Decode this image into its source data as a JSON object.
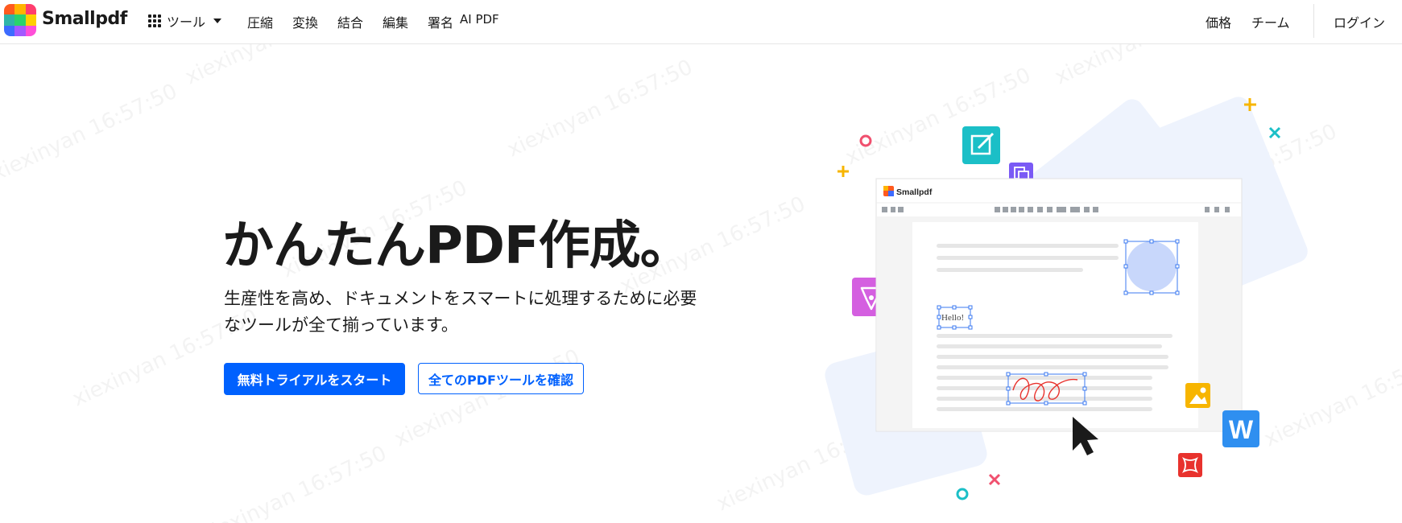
{
  "header": {
    "brand": "Smallpdf",
    "tools_label": "ツール",
    "nav": [
      "圧縮",
      "変換",
      "結合",
      "編集",
      "署名",
      "AI PDF"
    ],
    "price_label": "価格",
    "team_label": "チーム",
    "login_label": "ログイン"
  },
  "hero": {
    "title": "かんたんPDF作成。",
    "subtitle_line1": "生産性を高め、ドキュメントをスマートに処理するために必要",
    "subtitle_line2": "なツールが全て揃っています。",
    "primary_button": "無料トライアルをスタート",
    "secondary_button": "全てのPDFツールを確認"
  },
  "illustration": {
    "window_brand": "Smallpdf",
    "hello_text": "Hello!",
    "word_letter": "W"
  },
  "watermark": {
    "text": "xiexinyan 16:57:50"
  },
  "colors": {
    "accent": "#0061fe",
    "teal": "#1bbfc7",
    "purple": "#7a5af5",
    "magenta": "#d45fe0",
    "yellow": "#f7b500",
    "red": "#e8322d",
    "word_blue": "#2f8ff0"
  }
}
